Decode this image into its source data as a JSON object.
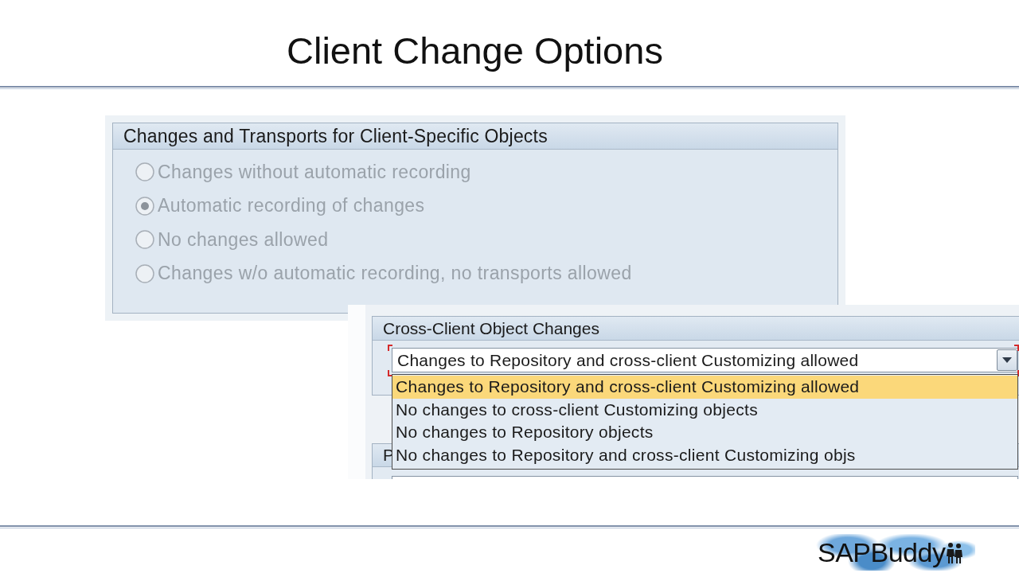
{
  "slide": {
    "title": "Client Change Options"
  },
  "client_specific_objects": {
    "title": "Changes and Transports for Client-Specific Objects",
    "options": [
      {
        "label": "Changes without automatic recording",
        "selected": false,
        "disabled": true
      },
      {
        "label": "Automatic recording of changes",
        "selected": true,
        "disabled": true
      },
      {
        "label": "No changes allowed",
        "selected": false,
        "disabled": true
      },
      {
        "label": "Changes w/o automatic recording, no transports allowed",
        "selected": false,
        "disabled": true
      }
    ]
  },
  "cross_client_object_changes": {
    "title": "Cross-Client Object Changes",
    "dropdown": {
      "value": "Changes to Repository and cross-client Customizing allowed",
      "expanded": true,
      "options": [
        {
          "label": "Changes to Repository and cross-client Customizing allowed",
          "selected": true
        },
        {
          "label": "No changes to cross-client Customizing objects",
          "selected": false
        },
        {
          "label": "No changes to Repository objects",
          "selected": false
        },
        {
          "label": "No changes to Repository and cross-client Customizing objs",
          "selected": false
        }
      ]
    },
    "next_group": {
      "title": "P"
    }
  },
  "logo": {
    "text": "SAPBuddy"
  }
}
